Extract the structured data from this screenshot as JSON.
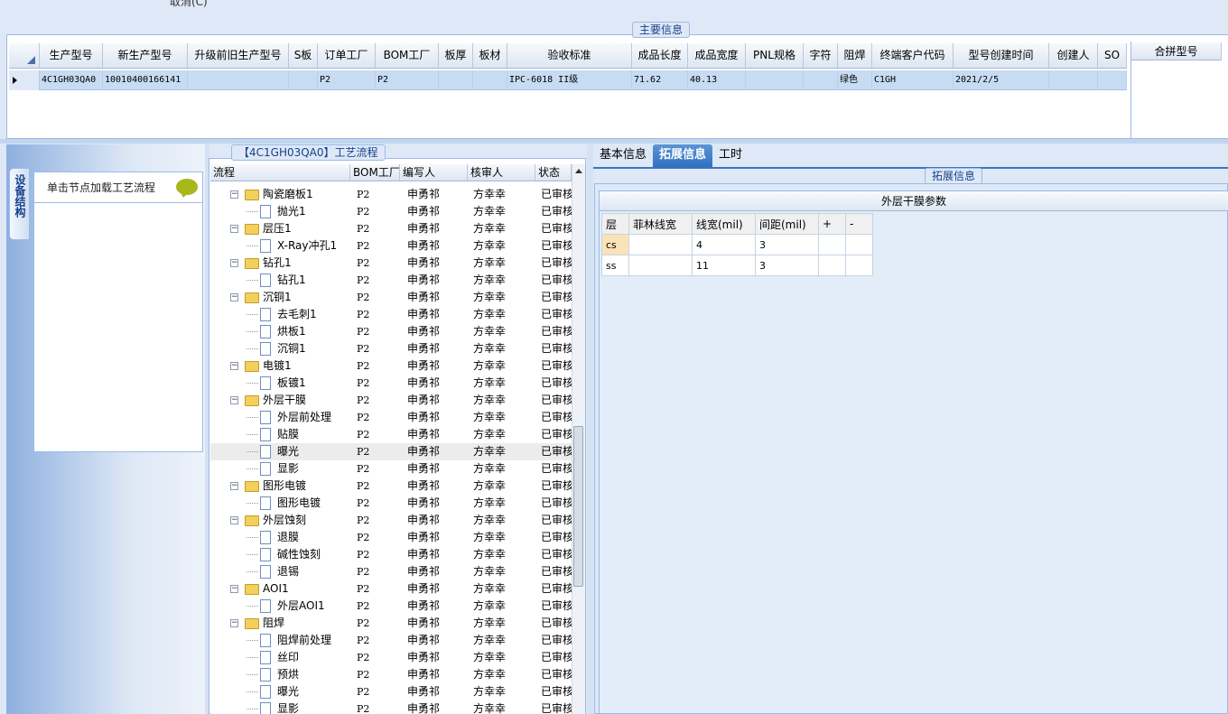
{
  "top": {
    "cut_text": "取消(C)"
  },
  "main_info": {
    "legend": "主要信息",
    "columns": [
      "生产型号",
      "新生产型号",
      "升级前旧生产型号",
      "S板",
      "订单工厂",
      "BOM工厂",
      "板厚",
      "板材",
      "验收标准",
      "成品长度",
      "成品宽度",
      "PNL规格",
      "字符",
      "阻焊",
      "终端客户代码",
      "型号创建时间",
      "创建人",
      "SO"
    ],
    "row": [
      "4C1GH03QA0",
      "10010400166141",
      "",
      "",
      "P2",
      "P2",
      "",
      "",
      "IPC-6018 II级",
      "71.62",
      "40.13",
      "",
      "",
      "绿色",
      "C1GH",
      "2021/2/5",
      "",
      ""
    ],
    "merge_header": "合拼型号"
  },
  "left": {
    "side_tab": "设备结构",
    "hint": "单击节点加载工艺流程"
  },
  "process": {
    "legend": "【4C1GH03QA0】工艺流程",
    "columns": [
      "流程",
      "BOM工厂",
      "编写人",
      "核审人",
      "状态"
    ],
    "rows": [
      {
        "name": "陶瓷磨板1",
        "type": "folder",
        "factory": "P2",
        "writer": "申勇祁",
        "reviewer": "方幸幸",
        "status": "已审核"
      },
      {
        "name": "抛光1",
        "type": "doc",
        "factory": "P2",
        "writer": "申勇祁",
        "reviewer": "方幸幸",
        "status": "已审核"
      },
      {
        "name": "层压1",
        "type": "folder",
        "factory": "P2",
        "writer": "申勇祁",
        "reviewer": "方幸幸",
        "status": "已审核"
      },
      {
        "name": "X-Ray冲孔1",
        "type": "doc",
        "factory": "P2",
        "writer": "申勇祁",
        "reviewer": "方幸幸",
        "status": "已审核"
      },
      {
        "name": "钻孔1",
        "type": "folder",
        "factory": "P2",
        "writer": "申勇祁",
        "reviewer": "方幸幸",
        "status": "已审核"
      },
      {
        "name": "钻孔1",
        "type": "doc",
        "factory": "P2",
        "writer": "申勇祁",
        "reviewer": "方幸幸",
        "status": "已审核"
      },
      {
        "name": "沉铜1",
        "type": "folder",
        "factory": "P2",
        "writer": "申勇祁",
        "reviewer": "方幸幸",
        "status": "已审核"
      },
      {
        "name": "去毛刺1",
        "type": "doc",
        "factory": "P2",
        "writer": "申勇祁",
        "reviewer": "方幸幸",
        "status": "已审核"
      },
      {
        "name": "烘板1",
        "type": "doc",
        "factory": "P2",
        "writer": "申勇祁",
        "reviewer": "方幸幸",
        "status": "已审核"
      },
      {
        "name": "沉铜1",
        "type": "doc",
        "factory": "P2",
        "writer": "申勇祁",
        "reviewer": "方幸幸",
        "status": "已审核"
      },
      {
        "name": "电镀1",
        "type": "folder",
        "factory": "P2",
        "writer": "申勇祁",
        "reviewer": "方幸幸",
        "status": "已审核"
      },
      {
        "name": "板镀1",
        "type": "doc",
        "factory": "P2",
        "writer": "申勇祁",
        "reviewer": "方幸幸",
        "status": "已审核"
      },
      {
        "name": "外层干膜",
        "type": "folder",
        "factory": "P2",
        "writer": "申勇祁",
        "reviewer": "方幸幸",
        "status": "已审核"
      },
      {
        "name": "外层前处理",
        "type": "doc",
        "factory": "P2",
        "writer": "申勇祁",
        "reviewer": "方幸幸",
        "status": "已审核"
      },
      {
        "name": "贴膜",
        "type": "doc",
        "factory": "P2",
        "writer": "申勇祁",
        "reviewer": "方幸幸",
        "status": "已审核"
      },
      {
        "name": "曝光",
        "type": "doc",
        "factory": "P2",
        "writer": "申勇祁",
        "reviewer": "方幸幸",
        "status": "已审核",
        "selected": true
      },
      {
        "name": "显影",
        "type": "doc",
        "factory": "P2",
        "writer": "申勇祁",
        "reviewer": "方幸幸",
        "status": "已审核"
      },
      {
        "name": "图形电镀",
        "type": "folder",
        "factory": "P2",
        "writer": "申勇祁",
        "reviewer": "方幸幸",
        "status": "已审核"
      },
      {
        "name": "图形电镀",
        "type": "doc",
        "factory": "P2",
        "writer": "申勇祁",
        "reviewer": "方幸幸",
        "status": "已审核"
      },
      {
        "name": "外层蚀刻",
        "type": "folder",
        "factory": "P2",
        "writer": "申勇祁",
        "reviewer": "方幸幸",
        "status": "已审核"
      },
      {
        "name": "退膜",
        "type": "doc",
        "factory": "P2",
        "writer": "申勇祁",
        "reviewer": "方幸幸",
        "status": "已审核"
      },
      {
        "name": "碱性蚀刻",
        "type": "doc",
        "factory": "P2",
        "writer": "申勇祁",
        "reviewer": "方幸幸",
        "status": "已审核"
      },
      {
        "name": "退锡",
        "type": "doc",
        "factory": "P2",
        "writer": "申勇祁",
        "reviewer": "方幸幸",
        "status": "已审核"
      },
      {
        "name": "AOI1",
        "type": "folder",
        "factory": "P2",
        "writer": "申勇祁",
        "reviewer": "方幸幸",
        "status": "已审核"
      },
      {
        "name": "外层AOI1",
        "type": "doc",
        "factory": "P2",
        "writer": "申勇祁",
        "reviewer": "方幸幸",
        "status": "已审核"
      },
      {
        "name": "阻焊",
        "type": "folder",
        "factory": "P2",
        "writer": "申勇祁",
        "reviewer": "方幸幸",
        "status": "已审核"
      },
      {
        "name": "阻焊前处理",
        "type": "doc",
        "factory": "P2",
        "writer": "申勇祁",
        "reviewer": "方幸幸",
        "status": "已审核"
      },
      {
        "name": "丝印",
        "type": "doc",
        "factory": "P2",
        "writer": "申勇祁",
        "reviewer": "方幸幸",
        "status": "已审核"
      },
      {
        "name": "预烘",
        "type": "doc",
        "factory": "P2",
        "writer": "申勇祁",
        "reviewer": "方幸幸",
        "status": "已审核"
      },
      {
        "name": "曝光",
        "type": "doc",
        "factory": "P2",
        "writer": "申勇祁",
        "reviewer": "方幸幸",
        "status": "已审核"
      },
      {
        "name": "显影",
        "type": "doc",
        "factory": "P2",
        "writer": "申勇祁",
        "reviewer": "方幸幸",
        "status": "已审核"
      }
    ]
  },
  "right": {
    "tabs": [
      "基本信息",
      "拓展信息",
      "工时"
    ],
    "active_tab": "拓展信息",
    "legend": "拓展信息",
    "section_title": "外层干膜参数",
    "param_columns": [
      "层",
      "菲林线宽",
      "线宽(mil)",
      "间距(mil)",
      "+",
      "-"
    ],
    "param_rows": [
      [
        "cs",
        "",
        "4",
        "3",
        "",
        ""
      ],
      [
        "ss",
        "",
        "11",
        "3",
        "",
        ""
      ]
    ]
  }
}
